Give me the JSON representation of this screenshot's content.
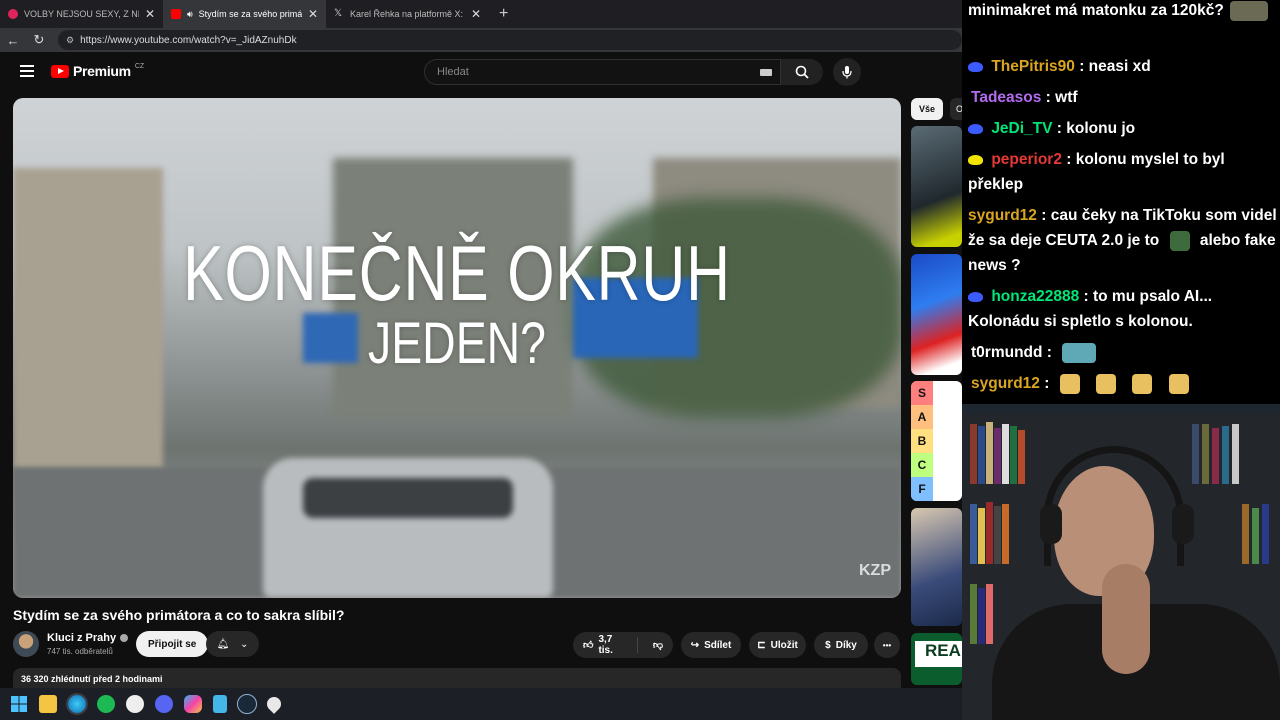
{
  "browser": {
    "tabs": [
      {
        "title": "VOLBY NEJSOU SEXY, Z NICH NEM",
        "active": false,
        "favicon_color": "#e0245e"
      },
      {
        "title": "Stydím se za svého primátora",
        "active": true,
        "favicon_color": "#ff0000"
      },
      {
        "title": "Karel Řehka na platformě X: „Po v",
        "active": false,
        "favicon_color": "#1f1f23"
      }
    ],
    "close_glyph": "✕",
    "new_tab_glyph": "+",
    "url": "https://www.youtube.com/watch?v=_JidAZnuhDk"
  },
  "youtube": {
    "logo_text": "Premium",
    "logo_country": "CZ",
    "search_placeholder": "Hledat",
    "video_overlay_line1": "KONEČNĚ OKRUH",
    "video_overlay_line2": "JEDEN?",
    "video_watermark": "KZP",
    "video_title": "Stydím se za svého primátora a co to sakra slíbil?",
    "channel_name": "Kluci z Prahy",
    "channel_subscribers": "747 tis. odběratelů",
    "join_label": "Připojit se",
    "like_count": "3,7 tis.",
    "share_label": "Sdílet",
    "save_label": "Uložit",
    "thanks_label": "Díky",
    "more_label": "•••",
    "description_meta": "36 320 zhlédnutí  před 2 hodinami",
    "chip_all": "Vše",
    "chip_other": "O",
    "tier_labels": [
      "S",
      "A",
      "B",
      "C",
      "F"
    ],
    "tier_colors": [
      "#ff7f7f",
      "#ffbf7f",
      "#ffdf7f",
      "#bfff7f",
      "#7fbfff"
    ],
    "promo_text": "REA"
  },
  "chat": {
    "messages": [
      {
        "user": "",
        "text": "minimakret má matonku za 120kč?",
        "user_color": "#ffffff",
        "badge_color": "",
        "emotes": 1
      },
      {
        "user": "ThePitris90",
        "text": ": neasi xd",
        "user_color": "#daa520",
        "badge_color": "#3b5bff",
        "emotes": 0
      },
      {
        "user": "Tadeasos",
        "text": ": wtf",
        "user_color": "#9b5de5",
        "badge_color": "",
        "emotes": 0
      },
      {
        "user": "JeDi_TV",
        "text": ": kolonu jo",
        "user_color": "#00e676",
        "badge_color": "#3b5bff",
        "emotes": 0
      },
      {
        "user": "peperior2",
        "text": ": kolonu myslel to byl překlep",
        "user_color": "#e53935",
        "badge_color": "#f2e600",
        "emotes": 0
      },
      {
        "user": "sygurd12",
        "text": ": cau čeky na TikToku som videl že sa deje CEUTA 2.0 je to",
        "text_tail": "alebo fake news ?",
        "user_color": "#daa520",
        "badge_color": "",
        "emotes": 1
      },
      {
        "user": "honza22888",
        "text": ": to mu psalo AI... Kolonádu si spletlo s kolonou.",
        "user_color": "#00e676",
        "badge_color": "#3b5bff",
        "emotes": 0
      },
      {
        "user": "t0rmundd",
        "text": ":",
        "user_color": "#ffffff",
        "badge_color": "",
        "emotes": 1
      },
      {
        "user": "sygurd12",
        "text": ":",
        "user_color": "#daa520",
        "badge_color": "",
        "emotes": 4
      }
    ]
  },
  "taskbar": {
    "icons": [
      "windows-start-icon",
      "file-explorer-icon",
      "edge-icon",
      "spotify-icon",
      "github-icon",
      "discord-icon",
      "copilot-icon",
      "notepad-icon",
      "steam-icon",
      "maps-icon"
    ]
  },
  "colors": {
    "youtube_red": "#ff0000",
    "page_bg": "#0f0f0f",
    "chat_bg": "#000000"
  }
}
